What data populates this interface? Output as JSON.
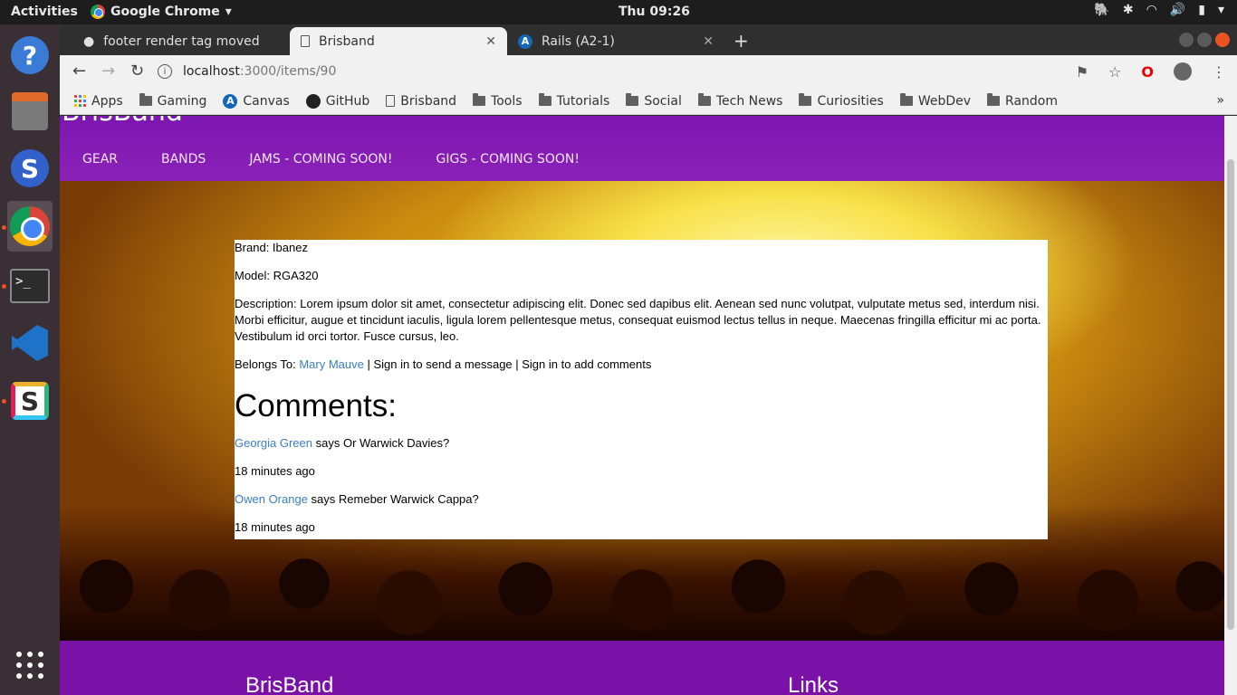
{
  "system": {
    "activities": "Activities",
    "app_name": "Google Chrome",
    "clock": "Thu 09:26"
  },
  "tabs": [
    {
      "title": "footer render tag moved",
      "icon": "github-icon"
    },
    {
      "title": "Brisband",
      "icon": "page-icon"
    },
    {
      "title": "Rails (A2-1)",
      "icon": "canvas-icon"
    }
  ],
  "toolbar": {
    "url_host": "localhost",
    "url_path": ":3000/items/90"
  },
  "bookmarks": [
    {
      "label": "Apps",
      "icon": "apps-grid-icon"
    },
    {
      "label": "Gaming",
      "icon": "folder-icon"
    },
    {
      "label": "Canvas",
      "icon": "canvas-icon"
    },
    {
      "label": "GitHub",
      "icon": "github-icon"
    },
    {
      "label": "Brisband",
      "icon": "page-icon"
    },
    {
      "label": "Tools",
      "icon": "folder-icon"
    },
    {
      "label": "Tutorials",
      "icon": "folder-icon"
    },
    {
      "label": "Social",
      "icon": "folder-icon"
    },
    {
      "label": "Tech News",
      "icon": "folder-icon"
    },
    {
      "label": "Curiosities",
      "icon": "folder-icon"
    },
    {
      "label": "WebDev",
      "icon": "folder-icon"
    },
    {
      "label": "Random",
      "icon": "folder-icon"
    }
  ],
  "site": {
    "brand": "BrisBand",
    "nav": [
      "GEAR",
      "BANDS",
      "JAMS - COMING SOON!",
      "GIGS - COMING SOON!"
    ],
    "item": {
      "brand_line": "Brand: Ibanez",
      "model_line": "Model: RGA320",
      "description_line": "Description: Lorem ipsum dolor sit amet, consectetur adipiscing elit. Donec sed dapibus elit. Aenean sed nunc volutpat, vulputate metus sed, interdum nisi. Morbi efficitur, augue et tincidunt iaculis, ligula lorem pellentesque metus, consequat euismod lectus tellus in neque. Maecenas fringilla efficitur mi ac porta. Vestibulum id orci tortor. Fusce cursus, leo.",
      "belongs_prefix": "Belongs To: ",
      "owner": "Mary Mauve",
      "belongs_suffix": " | Sign in to send a message | Sign in to add comments"
    },
    "comments_heading": "Comments:",
    "comments": [
      {
        "author": "Georgia Green",
        "text": " says Or Warwick Davies?",
        "time": "18 minutes ago"
      },
      {
        "author": "Owen Orange",
        "text": " says Remeber Warwick Cappa?",
        "time": "18 minutes ago"
      }
    ],
    "footer": {
      "brand": "BrisBand",
      "links_heading": "Links"
    }
  },
  "colors": {
    "header_purple": "#7d16b0",
    "footer_purple": "#7a12a8",
    "link_blue": "#3a7fc4"
  }
}
